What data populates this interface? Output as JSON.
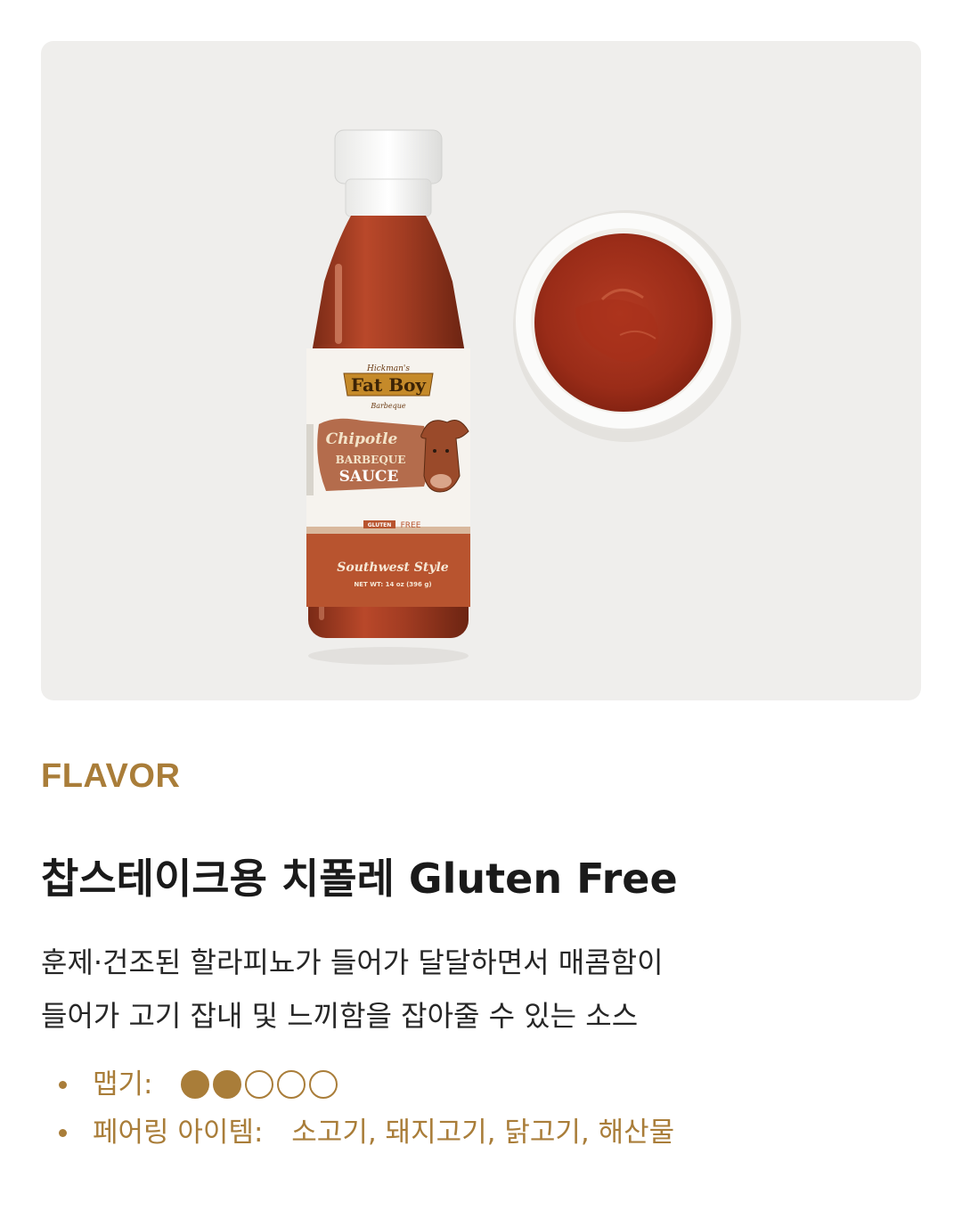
{
  "product_image": {
    "alt": "Chipotle Barbeque Sauce bottle and bowl",
    "label_brand_small": "Hickman's",
    "label_brand": "Fat Boy",
    "label_brand_sub": "Barbeque",
    "label_flavor": "Chipotle",
    "label_type_1": "BARBEQUE",
    "label_type_2": "SAUCE",
    "label_gluten": "GLUTEN",
    "label_free": "FREE",
    "label_style": "Southwest Style",
    "label_weight": "NET WT: 14 oz (396 g)"
  },
  "section_label": "FLAVOR",
  "product_title": "찹스테이크용 치폴레 Gluten Free",
  "description": {
    "line1": "훈제·건조된 할라피뇨가 들어가 달달하면서 매콤함이",
    "line2": "들어가 고기 잡내 및 느끼함을 잡아줄 수 있는 소스"
  },
  "attributes": {
    "spice": {
      "label": "맵기:",
      "level": 2,
      "max": 5
    },
    "pairing": {
      "label": "페어링 아이템:",
      "value": "소고기, 돼지고기, 닭고기, 해산물"
    }
  },
  "colors": {
    "accent": "#a97d39",
    "title": "#1a1a1a",
    "body_text": "#262626",
    "photo_background": "#efeeec"
  }
}
